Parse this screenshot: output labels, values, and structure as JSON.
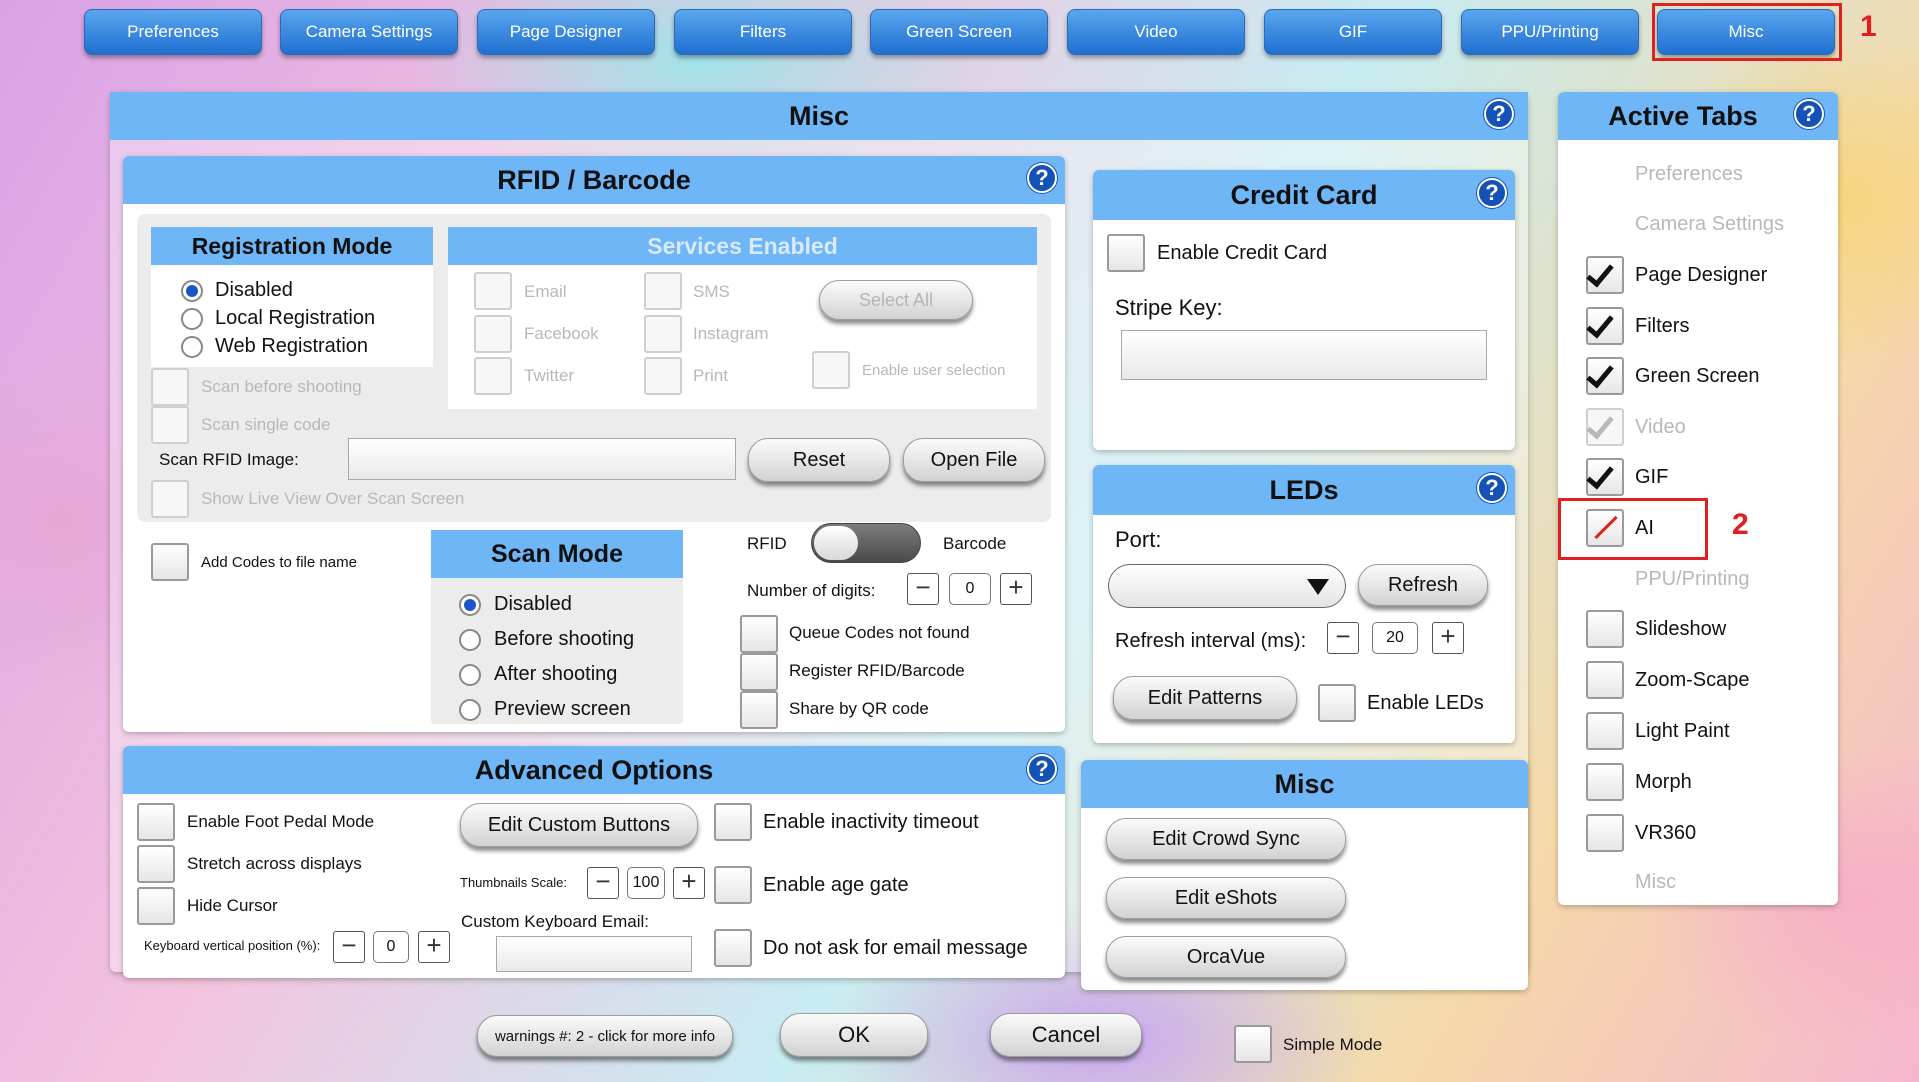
{
  "top_tabs": [
    "Preferences",
    "Camera Settings",
    "Page Designer",
    "Filters",
    "Green Screen",
    "Video",
    "GIF",
    "PPU/Printing",
    "Misc"
  ],
  "annotations": {
    "label1": "1",
    "label2": "2"
  },
  "main": {
    "title": "Misc"
  },
  "rfid": {
    "title": "RFID / Barcode",
    "registration": {
      "title": "Registration Mode",
      "options": [
        "Disabled",
        "Local Registration",
        "Web Registration"
      ]
    },
    "scan_before": "Scan before shooting",
    "scan_single": "Scan single code",
    "services": {
      "title": "Services Enabled",
      "email": "Email",
      "sms": "SMS",
      "facebook": "Facebook",
      "instagram": "Instagram",
      "twitter": "Twitter",
      "print": "Print",
      "select_all": "Select All",
      "enable_user_selection": "Enable user selection"
    },
    "scan_rfid_image_label": "Scan RFID Image:",
    "reset": "Reset",
    "open_file": "Open File",
    "show_live_view": "Show Live View Over Scan Screen",
    "add_codes": "Add Codes to file name",
    "scan_mode": {
      "title": "Scan Mode",
      "options": [
        "Disabled",
        "Before shooting",
        "After shooting",
        "Preview screen"
      ]
    },
    "toggle_left": "RFID",
    "toggle_right": "Barcode",
    "digits_label": "Number of digits:",
    "digits_value": "0",
    "queue": "Queue Codes not found",
    "register": "Register RFID/Barcode",
    "share_qr": "Share by QR code"
  },
  "advanced": {
    "title": "Advanced Options",
    "foot_pedal": "Enable Foot Pedal Mode",
    "stretch": "Stretch across displays",
    "hide_cursor": "Hide Cursor",
    "kb_pos_label": "Keyboard vertical position (%):",
    "kb_pos_value": "0",
    "edit_custom": "Edit Custom Buttons",
    "thumb_label": "Thumbnails Scale:",
    "thumb_value": "100",
    "custom_kb_email": "Custom Keyboard Email:",
    "inactivity": "Enable inactivity timeout",
    "age_gate": "Enable age gate",
    "no_email_msg": "Do not ask for email message"
  },
  "credit": {
    "title": "Credit Card",
    "enable": "Enable Credit Card",
    "stripe_label": "Stripe Key:"
  },
  "leds": {
    "title": "LEDs",
    "port_label": "Port:",
    "refresh": "Refresh",
    "interval_label": "Refresh interval (ms):",
    "interval_value": "20",
    "edit_patterns": "Edit Patterns",
    "enable": "Enable LEDs"
  },
  "misc_sub": {
    "title": "Misc",
    "crowd_sync": "Edit Crowd Sync",
    "eshots": "Edit eShots",
    "orcavue": "OrcaVue"
  },
  "active_tabs": {
    "title": "Active Tabs",
    "items": [
      "Preferences",
      "Camera Settings",
      "Page Designer",
      "Filters",
      "Green Screen",
      "Video",
      "GIF",
      "AI",
      "PPU/Printing",
      "Slideshow",
      "Zoom-Scape",
      "Light Paint",
      "Morph",
      "VR360",
      "Misc"
    ]
  },
  "footer": {
    "warnings": "warnings #: 2 - click for more info",
    "ok": "OK",
    "cancel": "Cancel",
    "simple_mode": "Simple Mode"
  }
}
